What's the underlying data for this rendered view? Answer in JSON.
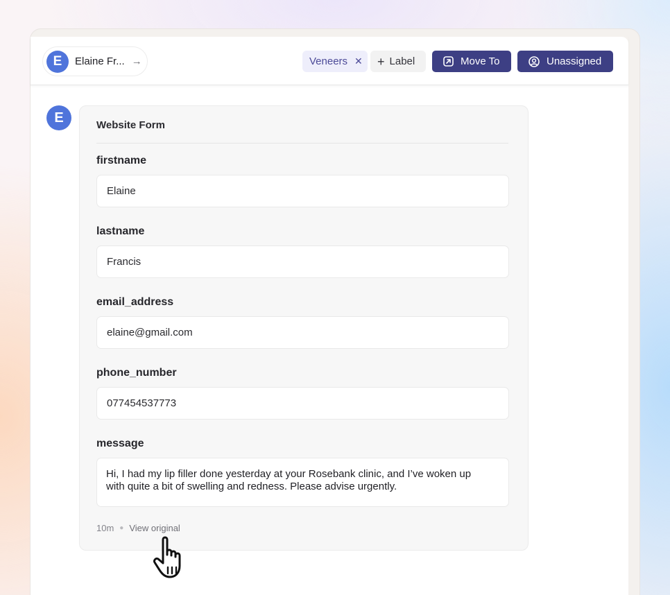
{
  "header": {
    "contact": {
      "initial": "E",
      "name": "Elaine Fr..."
    },
    "tag": {
      "label": "Veneers"
    },
    "add_label": "Label",
    "move_to": "Move To",
    "assignee": "Unassigned"
  },
  "message": {
    "avatar_initial": "E",
    "form_title": "Website Form",
    "fields": [
      {
        "label": "firstname",
        "value": "Elaine"
      },
      {
        "label": "lastname",
        "value": "Francis"
      },
      {
        "label": "email_address",
        "value": "elaine@gmail.com"
      },
      {
        "label": "phone_number",
        "value": "077454537773"
      }
    ],
    "message_label": "message",
    "message_text": "Hi, I had my lip filler done yesterday at your Rosebank clinic, and I’ve woken up with quite a bit of swelling and redness. Please advise urgently.",
    "time": "10m",
    "view_original": "View original"
  },
  "colors": {
    "accent": "#3d3f84",
    "avatar": "#4f74db",
    "tag_bg": "#eeeefb",
    "tag_text": "#4c4a98"
  },
  "icons": [
    "arrow-right-icon",
    "close-icon",
    "plus-icon",
    "move-to-icon",
    "user-circle-icon",
    "hand-pointer-icon"
  ]
}
